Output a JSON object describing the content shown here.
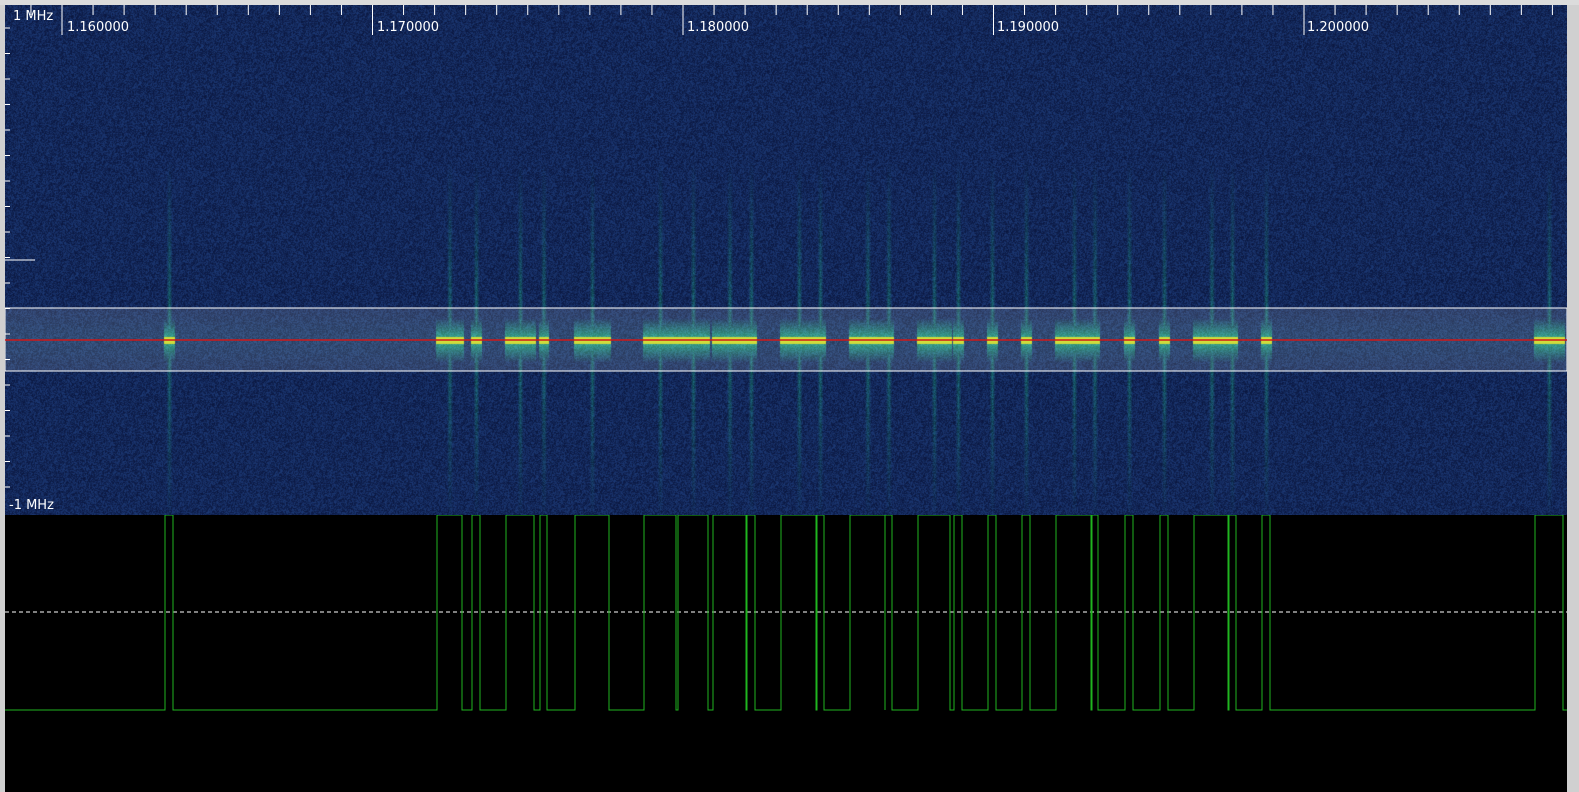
{
  "spectrogram": {
    "top_label": "1 MHz",
    "bottom_label": "-1 MHz",
    "freq_labels": [
      "1.160000",
      "1.170000",
      "1.180000",
      "1.190000",
      "1.200000"
    ],
    "colors": {
      "background": "#0c1847",
      "signal_low": "#1a7a8a",
      "signal_high": "#c8d418",
      "center_line": "#d01818",
      "selection": "#ffffff"
    }
  },
  "demod": {
    "signal_color": "#1fb51f",
    "threshold_color": "#ffffff",
    "background": "#000000",
    "pulse_boundaries": [
      160,
      168,
      432,
      457,
      467,
      475,
      501,
      529,
      535,
      542,
      570,
      604,
      639,
      671,
      673,
      703,
      708,
      741,
      742,
      750,
      776,
      812,
      811,
      819,
      845,
      880,
      880,
      887,
      913,
      945,
      949,
      957,
      983,
      991,
      1017,
      1025,
      1051,
      1087,
      1086,
      1093,
      1120,
      1128,
      1155,
      1163,
      1189,
      1224,
      1223,
      1231,
      1257,
      1265,
      1530,
      1558
    ]
  }
}
